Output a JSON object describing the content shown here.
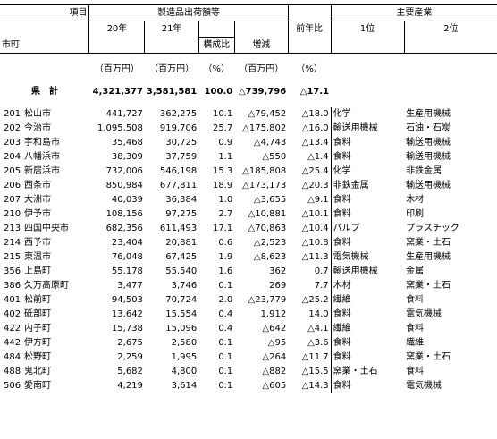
{
  "header": {
    "item_label": "項目",
    "city_label": "市町",
    "group_label": "製造品出荷額等",
    "main_industry_label": "主要産業",
    "col_20": "20年",
    "col_21": "21年",
    "col_share": "構成比",
    "col_change": "増減",
    "col_yoy": "前年比",
    "col_rank1": "1位",
    "col_rank2": "2位"
  },
  "units": {
    "u20": "（百万円）",
    "u21": "（百万円）",
    "ushare": "（%）",
    "uchange": "（百万円）",
    "uyoy": "（%）"
  },
  "total": {
    "label": "県　計",
    "v20": "4,321,377",
    "v21": "3,581,581",
    "share": "100.0",
    "change": "△739,796",
    "yoy": "△17.1"
  },
  "rows": [
    {
      "code": "201",
      "name": "松山市",
      "v20": "441,727",
      "v21": "362,275",
      "share": "10.1",
      "change": "△79,452",
      "yoy": "△18.0",
      "r1": "化学",
      "r2": "生産用機械"
    },
    {
      "code": "202",
      "name": "今治市",
      "v20": "1,095,508",
      "v21": "919,706",
      "share": "25.7",
      "change": "△175,802",
      "yoy": "△16.0",
      "r1": "輸送用機械",
      "r2": "石油・石炭"
    },
    {
      "code": "203",
      "name": "宇和島市",
      "v20": "35,468",
      "v21": "30,725",
      "share": "0.9",
      "change": "△4,743",
      "yoy": "△13.4",
      "r1": "食料",
      "r2": "輸送用機械"
    },
    {
      "code": "204",
      "name": "八幡浜市",
      "v20": "38,309",
      "v21": "37,759",
      "share": "1.1",
      "change": "△550",
      "yoy": "△1.4",
      "r1": "食料",
      "r2": "輸送用機械"
    },
    {
      "code": "205",
      "name": "新居浜市",
      "v20": "732,006",
      "v21": "546,198",
      "share": "15.3",
      "change": "△185,808",
      "yoy": "△25.4",
      "r1": "化学",
      "r2": "非鉄金属"
    },
    {
      "code": "206",
      "name": "西条市",
      "v20": "850,984",
      "v21": "677,811",
      "share": "18.9",
      "change": "△173,173",
      "yoy": "△20.3",
      "r1": "非鉄金属",
      "r2": "輸送用機械"
    },
    {
      "code": "207",
      "name": "大洲市",
      "v20": "40,039",
      "v21": "36,384",
      "share": "1.0",
      "change": "△3,655",
      "yoy": "△9.1",
      "r1": "食料",
      "r2": "木材"
    },
    {
      "code": "210",
      "name": "伊予市",
      "v20": "108,156",
      "v21": "97,275",
      "share": "2.7",
      "change": "△10,881",
      "yoy": "△10.1",
      "r1": "食料",
      "r2": "印刷"
    },
    {
      "code": "213",
      "name": "四国中央市",
      "v20": "682,356",
      "v21": "611,493",
      "share": "17.1",
      "change": "△70,863",
      "yoy": "△10.4",
      "r1": "パルプ",
      "r2": "プラスチック"
    },
    {
      "code": "214",
      "name": "西予市",
      "v20": "23,404",
      "v21": "20,881",
      "share": "0.6",
      "change": "△2,523",
      "yoy": "△10.8",
      "r1": "食料",
      "r2": "窯業・土石"
    },
    {
      "code": "215",
      "name": "東温市",
      "v20": "76,048",
      "v21": "67,425",
      "share": "1.9",
      "change": "△8,623",
      "yoy": "△11.3",
      "r1": "電気機械",
      "r2": "生産用機械"
    },
    {
      "code": "356",
      "name": "上島町",
      "v20": "55,178",
      "v21": "55,540",
      "share": "1.6",
      "change": "362",
      "yoy": "0.7",
      "r1": "輸送用機械",
      "r2": "金属"
    },
    {
      "code": "386",
      "name": "久万高原町",
      "v20": "3,477",
      "v21": "3,746",
      "share": "0.1",
      "change": "269",
      "yoy": "7.7",
      "r1": "木材",
      "r2": "窯業・土石"
    },
    {
      "code": "401",
      "name": "松前町",
      "v20": "94,503",
      "v21": "70,724",
      "share": "2.0",
      "change": "△23,779",
      "yoy": "△25.2",
      "r1": "繊維",
      "r2": "食料"
    },
    {
      "code": "402",
      "name": "砥部町",
      "v20": "13,642",
      "v21": "15,554",
      "share": "0.4",
      "change": "1,912",
      "yoy": "14.0",
      "r1": "食料",
      "r2": "電気機械"
    },
    {
      "code": "422",
      "name": "内子町",
      "v20": "15,738",
      "v21": "15,096",
      "share": "0.4",
      "change": "△642",
      "yoy": "△4.1",
      "r1": "繊維",
      "r2": "食料"
    },
    {
      "code": "442",
      "name": "伊方町",
      "v20": "2,675",
      "v21": "2,580",
      "share": "0.1",
      "change": "△95",
      "yoy": "△3.6",
      "r1": "食料",
      "r2": "繊維"
    },
    {
      "code": "484",
      "name": "松野町",
      "v20": "2,259",
      "v21": "1,995",
      "share": "0.1",
      "change": "△264",
      "yoy": "△11.7",
      "r1": "食料",
      "r2": "窯業・土石"
    },
    {
      "code": "488",
      "name": "鬼北町",
      "v20": "5,682",
      "v21": "4,800",
      "share": "0.1",
      "change": "△882",
      "yoy": "△15.5",
      "r1": "窯業・土石",
      "r2": "食料"
    },
    {
      "code": "506",
      "name": "愛南町",
      "v20": "4,219",
      "v21": "3,614",
      "share": "0.1",
      "change": "△605",
      "yoy": "△14.3",
      "r1": "食料",
      "r2": "電気機械"
    }
  ]
}
